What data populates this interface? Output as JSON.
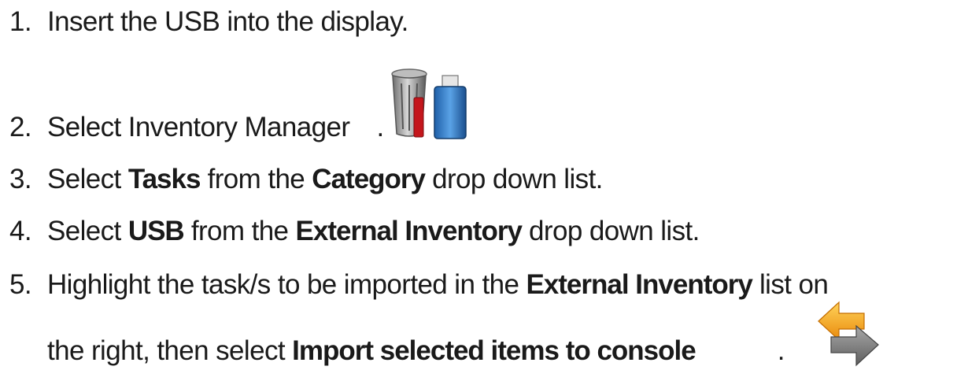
{
  "steps": [
    {
      "number": "1.",
      "text": "Insert the USB into the display."
    },
    {
      "number": "2.",
      "text": "Select Inventory Manager",
      "end": ".",
      "icon": "inventory-manager-icon"
    },
    {
      "number": "3.",
      "parts": [
        "Select ",
        "Tasks",
        " from the ",
        "Category",
        " drop down list."
      ]
    },
    {
      "number": "4.",
      "parts": [
        "Select ",
        "USB",
        " from the ",
        "External Inventory",
        " drop down list."
      ]
    },
    {
      "number": "5.",
      "parts": [
        "Highlight the task/s to be imported in the ",
        "External Inventory",
        " list on"
      ],
      "cont_parts": [
        "the right, then select ",
        "Import selected items to console"
      ],
      "end": ".",
      "icon": "import-to-console-icon"
    }
  ]
}
